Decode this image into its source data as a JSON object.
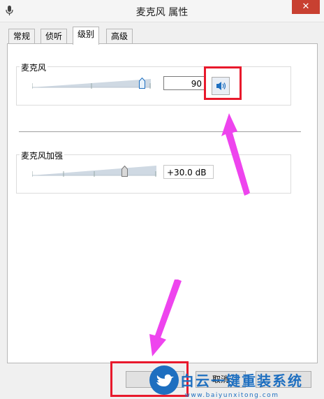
{
  "window": {
    "title": "麦克风 属性",
    "close_glyph": "✕"
  },
  "tabs": [
    {
      "label": "常规"
    },
    {
      "label": "侦听"
    },
    {
      "label": "级别"
    },
    {
      "label": "高级"
    }
  ],
  "levels": {
    "microphone": {
      "label": "麦克风",
      "value": "90",
      "level_fraction": 0.9,
      "mute_icon": "speaker-icon"
    },
    "boost": {
      "label": "麦克风加强",
      "value": "+30.0 dB",
      "level_fraction": 0.75
    }
  },
  "buttons": {
    "cancel": "取消"
  },
  "watermark": {
    "brand": "白云一键重装系统",
    "url": "www.baiyunxitong.com",
    "logo_icon": "twitter-bird-icon"
  },
  "colors": {
    "highlight_red": "#e8192c",
    "arrow_magenta": "#ee44ee",
    "close_red": "#c84031",
    "accent_blue": "#1e6fc0"
  }
}
